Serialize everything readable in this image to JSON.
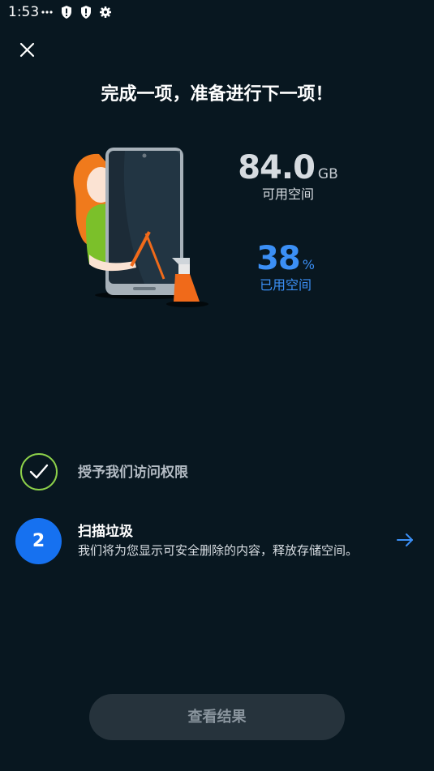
{
  "status_bar": {
    "time": "1:53",
    "icons": [
      "more-dots-icon",
      "shield-alert-icon",
      "shield-alert-icon",
      "settings-gear-icon"
    ]
  },
  "header": {
    "close_icon": "close-icon",
    "title": "完成一项，准备进行下一项！"
  },
  "storage": {
    "free_value": "84.0",
    "free_unit": "GB",
    "free_label": "可用空间",
    "used_value": "38",
    "used_unit": "%",
    "used_label": "已用空间"
  },
  "steps": [
    {
      "state": "done",
      "label": "授予我们访问权限",
      "icon": "checkmark-icon"
    },
    {
      "state": "active",
      "number": "2",
      "label": "扫描垃圾",
      "description": "我们将为您显示可安全删除的内容，释放存储空间。",
      "icon": "arrow-right-icon"
    }
  ],
  "footer": {
    "results_button": "查看结果"
  },
  "colors": {
    "background": "#081720",
    "accent": "#1671f0",
    "used_blue": "#3b8ff5",
    "success_green": "#8dd14a",
    "button_disabled": "#26333c"
  }
}
